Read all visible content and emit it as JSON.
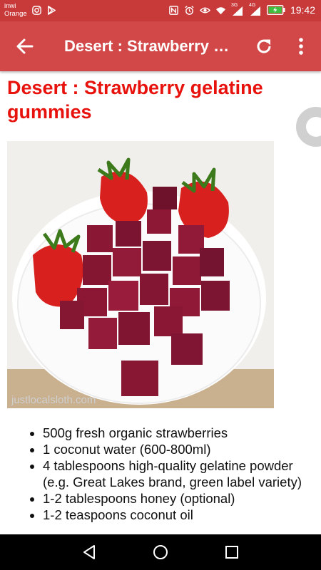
{
  "status_bar": {
    "carrier_line1": "inwi",
    "carrier_line2": "Orange",
    "signal_3g": "3G",
    "signal_4g": "4G",
    "time": "19:42",
    "icons": [
      "instagram-icon",
      "play-store-icon",
      "nfc-icon",
      "alarm-icon",
      "eye-icon",
      "wifi-icon",
      "signal-icon",
      "battery-charging-icon"
    ]
  },
  "toolbar": {
    "title": "Desert : Strawberry gelatine gummies",
    "icons": [
      "back-arrow-icon",
      "refresh-icon",
      "more-vert-icon"
    ]
  },
  "article": {
    "title": "Desert : Strawberry gelatine gummies",
    "image_watermark": "justlocalsloth.com",
    "ingredients": [
      "500g fresh organic strawberries",
      "1 coconut water (600-800ml)",
      "4 tablespoons high-quality gelatine powder (e.g. Great Lakes brand, green label variety)",
      "1-2 tablespoons honey (optional)",
      "1-2 teaspoons coconut oil"
    ]
  },
  "nav_bar": {
    "icons": [
      "back-triangle-icon",
      "home-circle-icon",
      "recents-square-icon"
    ]
  },
  "colors": {
    "status_bar": "#c83a3a",
    "toolbar": "#d24848",
    "title_red": "#e8120c"
  }
}
